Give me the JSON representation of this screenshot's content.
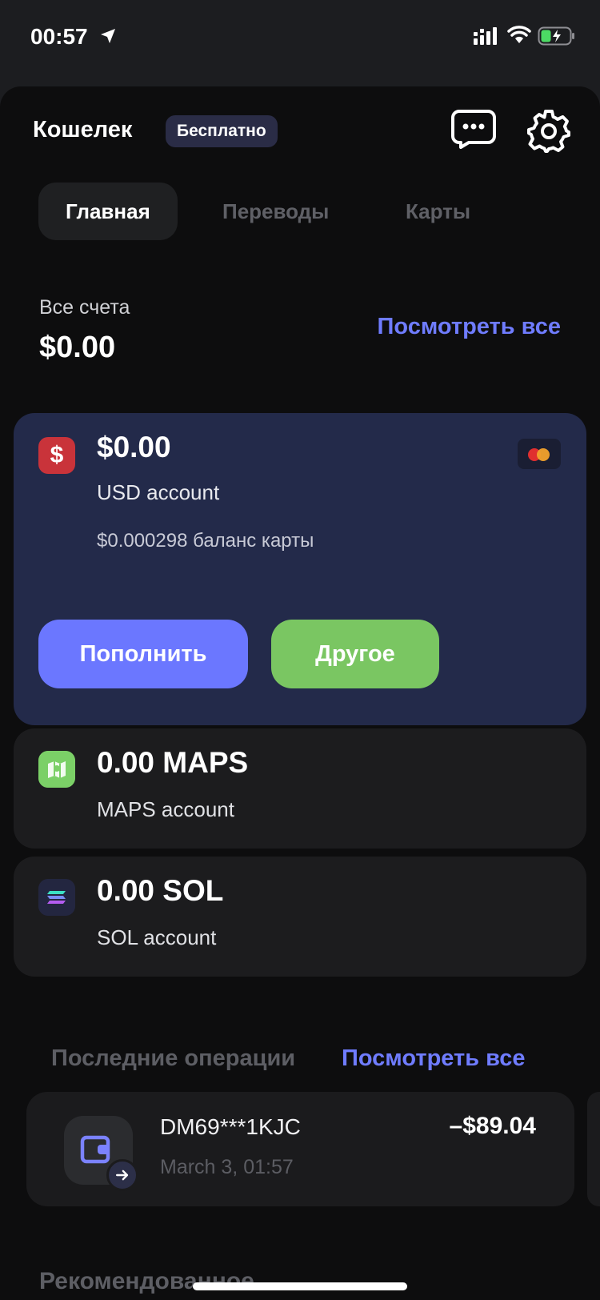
{
  "status_bar": {
    "time": "00:57"
  },
  "header": {
    "title": "Кошелек",
    "badge": "Бесплатно"
  },
  "tabs": [
    {
      "label": "Главная",
      "active": true
    },
    {
      "label": "Переводы",
      "active": false
    },
    {
      "label": "Карты",
      "active": false
    }
  ],
  "summary": {
    "label": "Все счета",
    "total": "$0.00",
    "see_all": "Посмотреть все"
  },
  "accounts": [
    {
      "amount": "$0.00",
      "name": "USD account",
      "card_balance": "$0.000298 баланс карты",
      "icon": "dollar-icon",
      "color": "#c9333a"
    },
    {
      "amount": "0.00 MAPS",
      "name": "MAPS account",
      "icon": "maps-icon",
      "color": "#7bd067"
    },
    {
      "amount": "0.00 SOL",
      "name": "SOL account",
      "icon": "solana-icon",
      "color": "#232640"
    }
  ],
  "actions": {
    "topup": "Пополнить",
    "other": "Другое"
  },
  "operations": {
    "title": "Последние операции",
    "see_all": "Посмотреть все",
    "items": [
      {
        "name": "DM69***1KJC",
        "date": "March 3, 01:57",
        "amount": "–$89.04",
        "icon": "wallet-icon"
      }
    ]
  },
  "recommended": {
    "title": "Рекомендованное"
  },
  "colors": {
    "accent": "#6f7cff",
    "topup_button": "#6b77ff",
    "other_button": "#7ac662",
    "usd_card_bg": "#232a4a"
  }
}
